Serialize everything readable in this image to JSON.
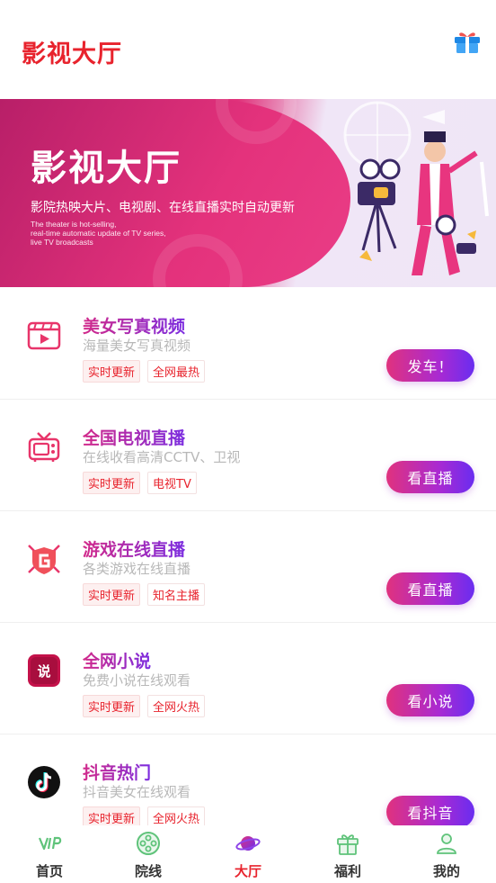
{
  "header": {
    "title": "影视大厅"
  },
  "banner": {
    "title": "影视大厅",
    "subtitle": "影院热映大片、电视剧、在线直播实时自动更新",
    "english_line1": "The theater is hot-selling,",
    "english_line2": "real-time automatic update of TV series,",
    "english_line3": "live TV broadcasts"
  },
  "items": [
    {
      "title": "美女写真视频",
      "desc": "海量美女写真视频",
      "tag1": "实时更新",
      "tag2": "全网最热",
      "button": "发车！",
      "icon": "video-icon"
    },
    {
      "title": "全国电视直播",
      "desc": "在线收看高清CCTV、卫视",
      "tag1": "实时更新",
      "tag2": "电视TV",
      "button": "看直播",
      "icon": "tv-icon"
    },
    {
      "title": "游戏在线直播",
      "desc": "各类游戏在线直播",
      "tag1": "实时更新",
      "tag2": "知名主播",
      "button": "看直播",
      "icon": "game-shield-icon"
    },
    {
      "title": "全网小说",
      "desc": "免费小说在线观看",
      "tag1": "实时更新",
      "tag2": "全网火热",
      "button": "看小说",
      "icon": "novel-icon"
    },
    {
      "title": "抖音热门",
      "desc": "抖音美女在线观看",
      "tag1": "实时更新",
      "tag2": "全网火热",
      "button": "看抖音",
      "icon": "tiktok-icon"
    }
  ],
  "novel_icon_text": "说",
  "tabs": [
    {
      "label": "首页",
      "icon": "vip-icon"
    },
    {
      "label": "院线",
      "icon": "film-reel-icon"
    },
    {
      "label": "大厅",
      "icon": "planet-icon",
      "active": true
    },
    {
      "label": "福利",
      "icon": "gift-icon"
    },
    {
      "label": "我的",
      "icon": "user-icon"
    }
  ],
  "colors": {
    "accent": "#e8232d",
    "gradient_start": "#e0327e",
    "gradient_end": "#6a2df0",
    "tab_green": "#5fc37a"
  }
}
